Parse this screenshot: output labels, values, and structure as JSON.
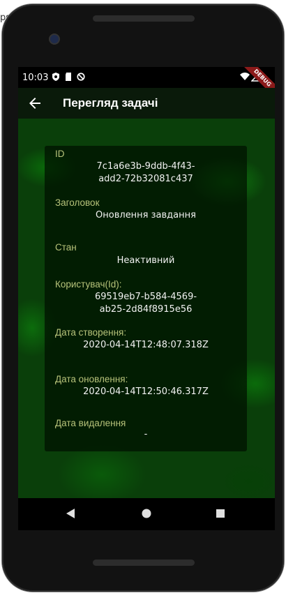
{
  "background_window": {
    "partial_text": "ps"
  },
  "status_bar": {
    "time": "10:03",
    "debug_label": "DEBUG"
  },
  "app_bar": {
    "title": "Перегляд задачі"
  },
  "task": {
    "id_label": "ID",
    "id_line1": "7c1a6e3b-9ddb-4f43-",
    "id_line2": "add2-72b32081c437",
    "title_label": "Заголовок",
    "title_value": "Оновлення завдання",
    "state_label": "Стан",
    "state_value": "Неактивний",
    "user_label": "Користувач(Id):",
    "user_line1": "69519eb7-b584-4569-",
    "user_line2": "ab25-2d84f8915e56",
    "created_label": "Дата створення:",
    "created_value": "2020-04-14T12:48:07.318Z",
    "updated_label": "Дата оновлення:",
    "updated_value": "2020-04-14T12:50:46.317Z",
    "deleted_label": "Дата видалення",
    "deleted_value": "-"
  },
  "colors": {
    "label": "#b7c27a",
    "value": "#f2f2f2",
    "app_bar": "#0a1a0a",
    "background": "#0a3f0a"
  }
}
